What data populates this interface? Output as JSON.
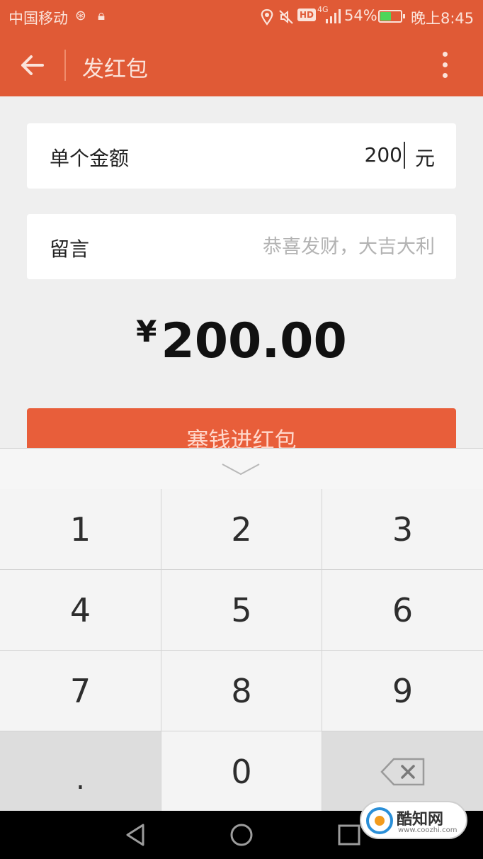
{
  "status_bar": {
    "carrier": "中国移动",
    "network": "4G",
    "hd_label": "HD",
    "battery_percent": "54%",
    "battery_level": 0.54,
    "time": "晚上8:45"
  },
  "app_bar": {
    "title": "发红包"
  },
  "form": {
    "amount_label": "单个金额",
    "amount_value": "200",
    "amount_unit": "元",
    "message_label": "留言",
    "message_placeholder": "恭喜发财，大吉大利"
  },
  "total": {
    "currency": "¥",
    "amount": "200.00"
  },
  "submit_button": {
    "label": "塞钱进红包"
  },
  "keypad": {
    "keys": [
      "1",
      "2",
      "3",
      "4",
      "5",
      "6",
      "7",
      "8",
      "9",
      ".",
      "0"
    ]
  },
  "watermark": {
    "name": "酷知网",
    "url": "www.coozhi.com"
  },
  "colors": {
    "accent": "#e05a36",
    "button": "#e85e3a",
    "background": "#efefef"
  }
}
